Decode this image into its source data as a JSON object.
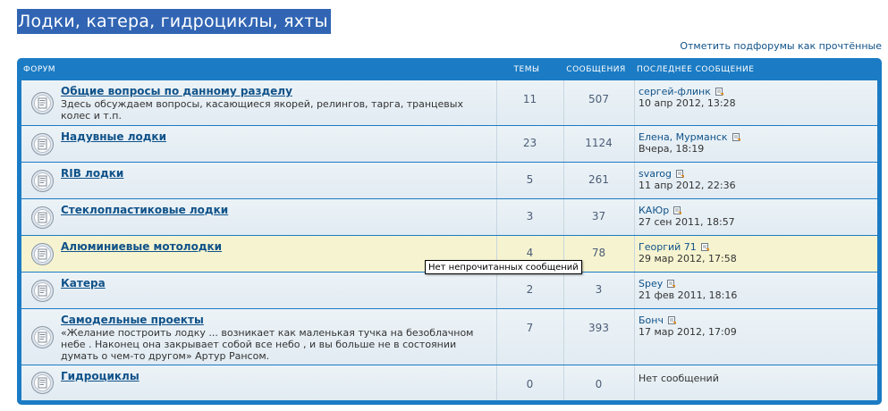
{
  "page": {
    "title": "Лодки, катера, гидроциклы, яхты",
    "mark_read_link": "Отметить подфорумы как прочтённые"
  },
  "table": {
    "headers": {
      "forum": "ФОРУМ",
      "topics": "ТЕМЫ",
      "posts": "СООБЩЕНИЯ",
      "last_post": "ПОСЛЕДНЕЕ СООБЩЕНИЕ"
    },
    "forums": [
      {
        "title": "Общие вопросы по данному разделу",
        "description": "Здесь обсуждаем вопросы, касающиеся якорей, релингов, тарга, транцевых колес и т.п.",
        "topics": "11",
        "posts": "507",
        "last_author": "сергей-флинк",
        "last_date": "10 апр 2012, 13:28",
        "icon": "forum-read-icon"
      },
      {
        "title": "Надувные лодки",
        "description": "",
        "topics": "23",
        "posts": "1124",
        "last_author": "Елена, Мурманск",
        "last_date": "Вчера, 18:19",
        "icon": "forum-read-icon"
      },
      {
        "title": "RIB лодки",
        "description": "",
        "topics": "5",
        "posts": "261",
        "last_author": "svarog",
        "last_date": "11 апр 2012, 22:36",
        "icon": "forum-read-icon"
      },
      {
        "title": "Стеклопластиковые лодки",
        "description": "",
        "topics": "3",
        "posts": "37",
        "last_author": "КАЮр",
        "last_date": "27 сен 2011, 18:57",
        "icon": "forum-read-icon"
      },
      {
        "title": "Алюминиевые мотолодки",
        "description": "",
        "topics": "4",
        "posts": "78",
        "last_author": "Георгий 71",
        "last_date": "29 мар 2012, 17:58",
        "icon": "forum-read-icon"
      },
      {
        "title": "Катера",
        "description": "",
        "topics": "2",
        "posts": "3",
        "last_author": "Spey",
        "last_date": "21 фев 2011, 18:16",
        "icon": "forum-read-icon"
      },
      {
        "title": "Самодельные проекты",
        "description": "«Желание построить лодку ... возникает как маленькая тучка на безоблачном небе . Наконец она закрывает собой все небо , и вы больше не в состоянии думать о чем-то другом» Артур Рансом.",
        "topics": "7",
        "posts": "393",
        "last_author": "Бонч",
        "last_date": "17 мар 2012, 17:09",
        "icon": "forum-read-icon"
      },
      {
        "title": "Гидроциклы",
        "description": "",
        "topics": "0",
        "posts": "0",
        "last_none": "Нет сообщений",
        "icon": "forum-read-icon"
      }
    ]
  },
  "tooltip": {
    "text": "Нет непрочитанных сообщений"
  },
  "colors": {
    "accent": "#1b7bc4",
    "title_bg": "#3165b4",
    "link": "#105289",
    "row_bg": "#e1ebf2",
    "row_hover": "#f6f4d0"
  }
}
